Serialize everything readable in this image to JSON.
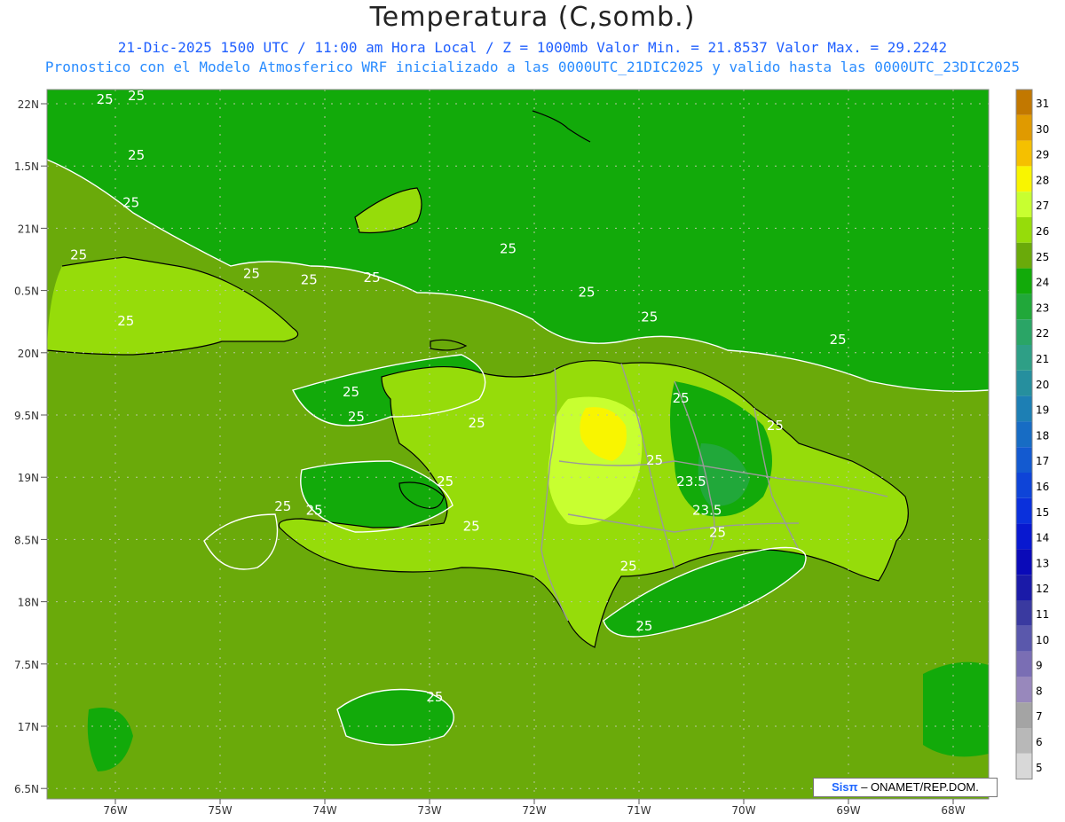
{
  "header": {
    "title": "Temperatura (C,somb.)",
    "line1": "21-Dic-2025 1500 UTC / 11:00 am Hora Local / Z = 1000mb  Valor Min. = 21.8537  Valor Max. = 29.2242",
    "line2": "Pronostico con el Modelo Atmosferico WRF inicializado a las 0000UTC_21DIC2025 y valido hasta las  0000UTC_23DIC2025"
  },
  "credit": {
    "brand": "Sisπ",
    "text": "– ONAMET/REP.DOM."
  },
  "axes": {
    "lat_labels": [
      "22N",
      "1.5N",
      "21N",
      "0.5N",
      "20N",
      "9.5N",
      "19N",
      "8.5N",
      "18N",
      "7.5N",
      "17N",
      "6.5N"
    ],
    "lon_labels": [
      "76W",
      "75W",
      "74W",
      "73W",
      "72W",
      "71W",
      "70W",
      "69W",
      "68W"
    ],
    "lat_range": [
      16.5,
      22.0
    ],
    "lon_range": [
      -76.6,
      -67.6
    ]
  },
  "colorbar": {
    "labels": [
      "31",
      "30",
      "29",
      "28",
      "27",
      "26",
      "25",
      "24",
      "23",
      "22",
      "21",
      "20",
      "19",
      "18",
      "17",
      "16",
      "15",
      "14",
      "13",
      "12",
      "11",
      "10",
      "9",
      "8",
      "7",
      "6",
      "5"
    ],
    "colors": [
      "#c27800",
      "#e09a00",
      "#f5c000",
      "#f9f500",
      "#c8ff30",
      "#96dc0a",
      "#6aaa0a",
      "#12aa0a",
      "#21a83a",
      "#2aa566",
      "#2e9f86",
      "#268f9e",
      "#1d7fb4",
      "#176cc4",
      "#135ad0",
      "#0e44d8",
      "#0a30dc",
      "#0818d0",
      "#0a0ab8",
      "#1a1aa8",
      "#3a3aa0",
      "#5a58ac",
      "#7a6eb4",
      "#9888bc",
      "#a4a4a4",
      "#b8b8b8",
      "#d8d8d8"
    ]
  },
  "map": {
    "contour_labels": [
      {
        "text": "25",
        "lon": -76.1,
        "lat": 22.0
      },
      {
        "text": "25",
        "lon": -75.8,
        "lat": 22.03
      },
      {
        "text": "25",
        "lon": -75.8,
        "lat": 21.55
      },
      {
        "text": "25",
        "lon": -75.85,
        "lat": 21.17
      },
      {
        "text": "25",
        "lon": -76.35,
        "lat": 20.75
      },
      {
        "text": "25",
        "lon": -74.7,
        "lat": 20.6
      },
      {
        "text": "25",
        "lon": -74.15,
        "lat": 20.55
      },
      {
        "text": "25",
        "lon": -75.9,
        "lat": 20.22
      },
      {
        "text": "25",
        "lon": -73.55,
        "lat": 20.57
      },
      {
        "text": "25",
        "lon": -72.25,
        "lat": 20.8
      },
      {
        "text": "25",
        "lon": -71.5,
        "lat": 20.45
      },
      {
        "text": "25",
        "lon": -70.9,
        "lat": 20.25
      },
      {
        "text": "25",
        "lon": -69.1,
        "lat": 20.07
      },
      {
        "text": "25",
        "lon": -73.75,
        "lat": 19.65
      },
      {
        "text": "25",
        "lon": -73.7,
        "lat": 19.45
      },
      {
        "text": "25",
        "lon": -72.55,
        "lat": 19.4
      },
      {
        "text": "25",
        "lon": -70.6,
        "lat": 19.6
      },
      {
        "text": "25",
        "lon": -69.7,
        "lat": 19.38
      },
      {
        "text": "25",
        "lon": -70.85,
        "lat": 19.1
      },
      {
        "text": "25",
        "lon": -72.85,
        "lat": 18.93
      },
      {
        "text": "25",
        "lon": -74.4,
        "lat": 18.73
      },
      {
        "text": "25",
        "lon": -74.1,
        "lat": 18.7
      },
      {
        "text": "23.5",
        "lon": -70.5,
        "lat": 18.93
      },
      {
        "text": "23.5",
        "lon": -70.35,
        "lat": 18.7
      },
      {
        "text": "25",
        "lon": -72.6,
        "lat": 18.57
      },
      {
        "text": "25",
        "lon": -70.25,
        "lat": 18.52
      },
      {
        "text": "25",
        "lon": -71.1,
        "lat": 18.25
      },
      {
        "text": "25",
        "lon": -70.95,
        "lat": 17.77
      },
      {
        "text": "25",
        "lon": -72.95,
        "lat": 17.2
      }
    ],
    "colors": {
      "ocean": "#6aaa0a",
      "warm": "#96dc0a",
      "hot": "#c8ff30",
      "hottest": "#f9f500",
      "cool": "#12aa0a",
      "cooler": "#21a83a"
    }
  }
}
